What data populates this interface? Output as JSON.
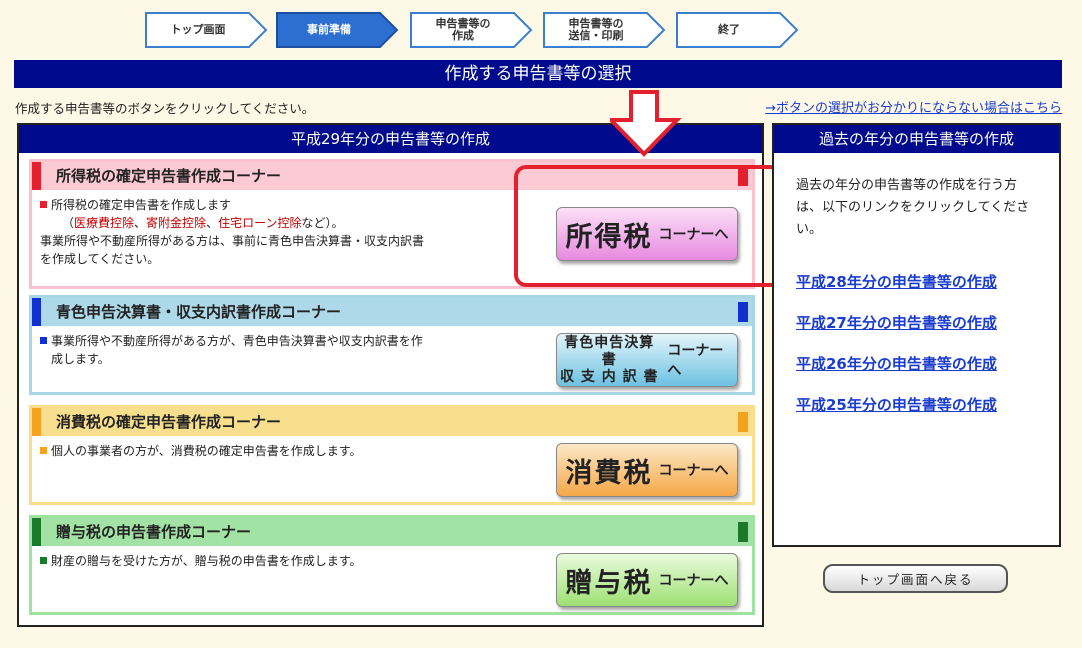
{
  "steps": [
    {
      "line1": "トップ画面",
      "line2": "",
      "active": false
    },
    {
      "line1": "事前準備",
      "line2": "",
      "active": true
    },
    {
      "line1": "申告書等の",
      "line2": "作成",
      "active": false
    },
    {
      "line1": "申告書等の",
      "line2": "送信・印刷",
      "active": false
    },
    {
      "line1": "終了",
      "line2": "",
      "active": false
    }
  ],
  "page_title": "作成する申告書等の選択",
  "instruction": "作成する申告書等のボタンをクリックしてください。",
  "help_link": "→ボタンの選択がお分かりにならない場合はこちら",
  "main_panel": {
    "title": "平成29年分の申告書等の作成",
    "corners": {
      "income": {
        "title": "所得税の確定申告書作成コーナー",
        "line1": "所得税の確定申告書を作成します",
        "paren_open": "（",
        "deduction1": "医療費控除",
        "sep1": "、",
        "deduction2": "寄附金控除",
        "sep2": "、",
        "deduction3": "住宅ローン控除",
        "paren_close": "など）。",
        "line3": "事業所得や不動産所得がある方は、事前に青色申告決算書・収支内訳書",
        "line4": "を作成してください。",
        "btn_main": "所得税",
        "btn_sub": "コーナーへ"
      },
      "blue": {
        "title": "青色申告決算書・収支内訳書作成コーナー",
        "line1": "事業所得や不動産所得がある方が、青色申告決算書や収支内訳書を作",
        "line2": "成します。",
        "btn_line1": "青色申告決算書",
        "btn_line2": "収 支 内 訳 書",
        "btn_sub": "コーナーへ"
      },
      "consumption": {
        "title": "消費税の確定申告書作成コーナー",
        "line1": "個人の事業者の方が、消費税の確定申告書を作成します。",
        "btn_main": "消費税",
        "btn_sub": "コーナーへ"
      },
      "gift": {
        "title": "贈与税の申告書作成コーナー",
        "line1": "財産の贈与を受けた方が、贈与税の申告書を作成します。",
        "btn_main": "贈与税",
        "btn_sub": "コーナーへ"
      }
    }
  },
  "side_panel": {
    "title": "過去の年分の申告書等の作成",
    "text": "過去の年分の申告書等の作成を行う方は、以下のリンクをクリックしてください。",
    "links": [
      "平成28年分の申告書等の作成",
      "平成27年分の申告書等の作成",
      "平成26年分の申告書等の作成",
      "平成25年分の申告書等の作成"
    ]
  },
  "back_button": "トップ画面へ戻る",
  "colors": {
    "navy": "#000a8c",
    "link": "#1a3ccf",
    "highlight": "#e5202e",
    "income_mark": "#e5202e",
    "blue_mark": "#1030d0",
    "consumption_mark": "#f5a21e",
    "gift_mark": "#1b7a2a"
  }
}
